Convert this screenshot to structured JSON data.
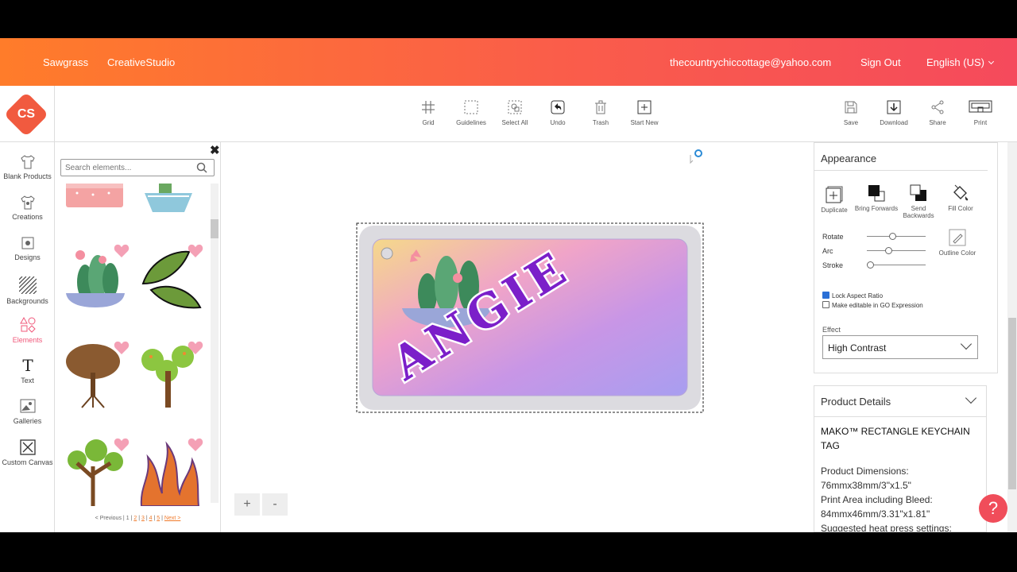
{
  "header": {
    "brand1": "Sawgrass",
    "brand2": "CreativeStudio",
    "email": "thecountrychiccottage@yahoo.com",
    "signout": "Sign Out",
    "language": "English (US)"
  },
  "logo": {
    "text": "CS"
  },
  "toolbar": {
    "grid": "Grid",
    "guidelines": "Guidelines",
    "select_all": "Select All",
    "undo": "Undo",
    "trash": "Trash",
    "start_new": "Start New",
    "save": "Save",
    "download": "Download",
    "share": "Share",
    "print": "Print"
  },
  "nav": {
    "blank_products": "Blank Products",
    "creations": "Creations",
    "designs": "Designs",
    "backgrounds": "Backgrounds",
    "elements": "Elements",
    "text": "Text",
    "galleries": "Galleries",
    "custom_canvas": "Custom Canvas"
  },
  "elements_panel": {
    "close": "✖",
    "search_placeholder": "Search elements...",
    "pager": {
      "prev": "< Previous",
      "sep": "|",
      "pages": [
        "1",
        "2",
        "3",
        "4",
        "5"
      ],
      "next": "Next >"
    }
  },
  "canvas": {
    "design_text": "ANGIE",
    "zoom_in": "+",
    "zoom_out": "-"
  },
  "appearance": {
    "title": "Appearance",
    "duplicate": "Duplicate",
    "bring_forwards": "Bring Forwards",
    "send_backwards": "Send Backwards",
    "fill_color": "Fill Color",
    "outline_color": "Outline Color",
    "rotate": "Rotate",
    "arc": "Arc",
    "stroke": "Stroke",
    "lock_aspect": "Lock Aspect Ratio",
    "editable_go": "Make editable in GO Expression",
    "effect_label": "Effect",
    "effect_value": "High Contrast"
  },
  "product": {
    "title": "Product Details",
    "name": "MAKO™ RECTANGLE KEYCHAIN TAG",
    "dims_label": "Product Dimensions:",
    "dims_value": "76mmx38mm/3\"x1.5\"",
    "print_label": "Print Area including Bleed:",
    "print_value": "84mmx46mm/3.31\"x1.81\"",
    "heat_label": "Suggested heat press settings:"
  },
  "help": {
    "label": "?"
  }
}
